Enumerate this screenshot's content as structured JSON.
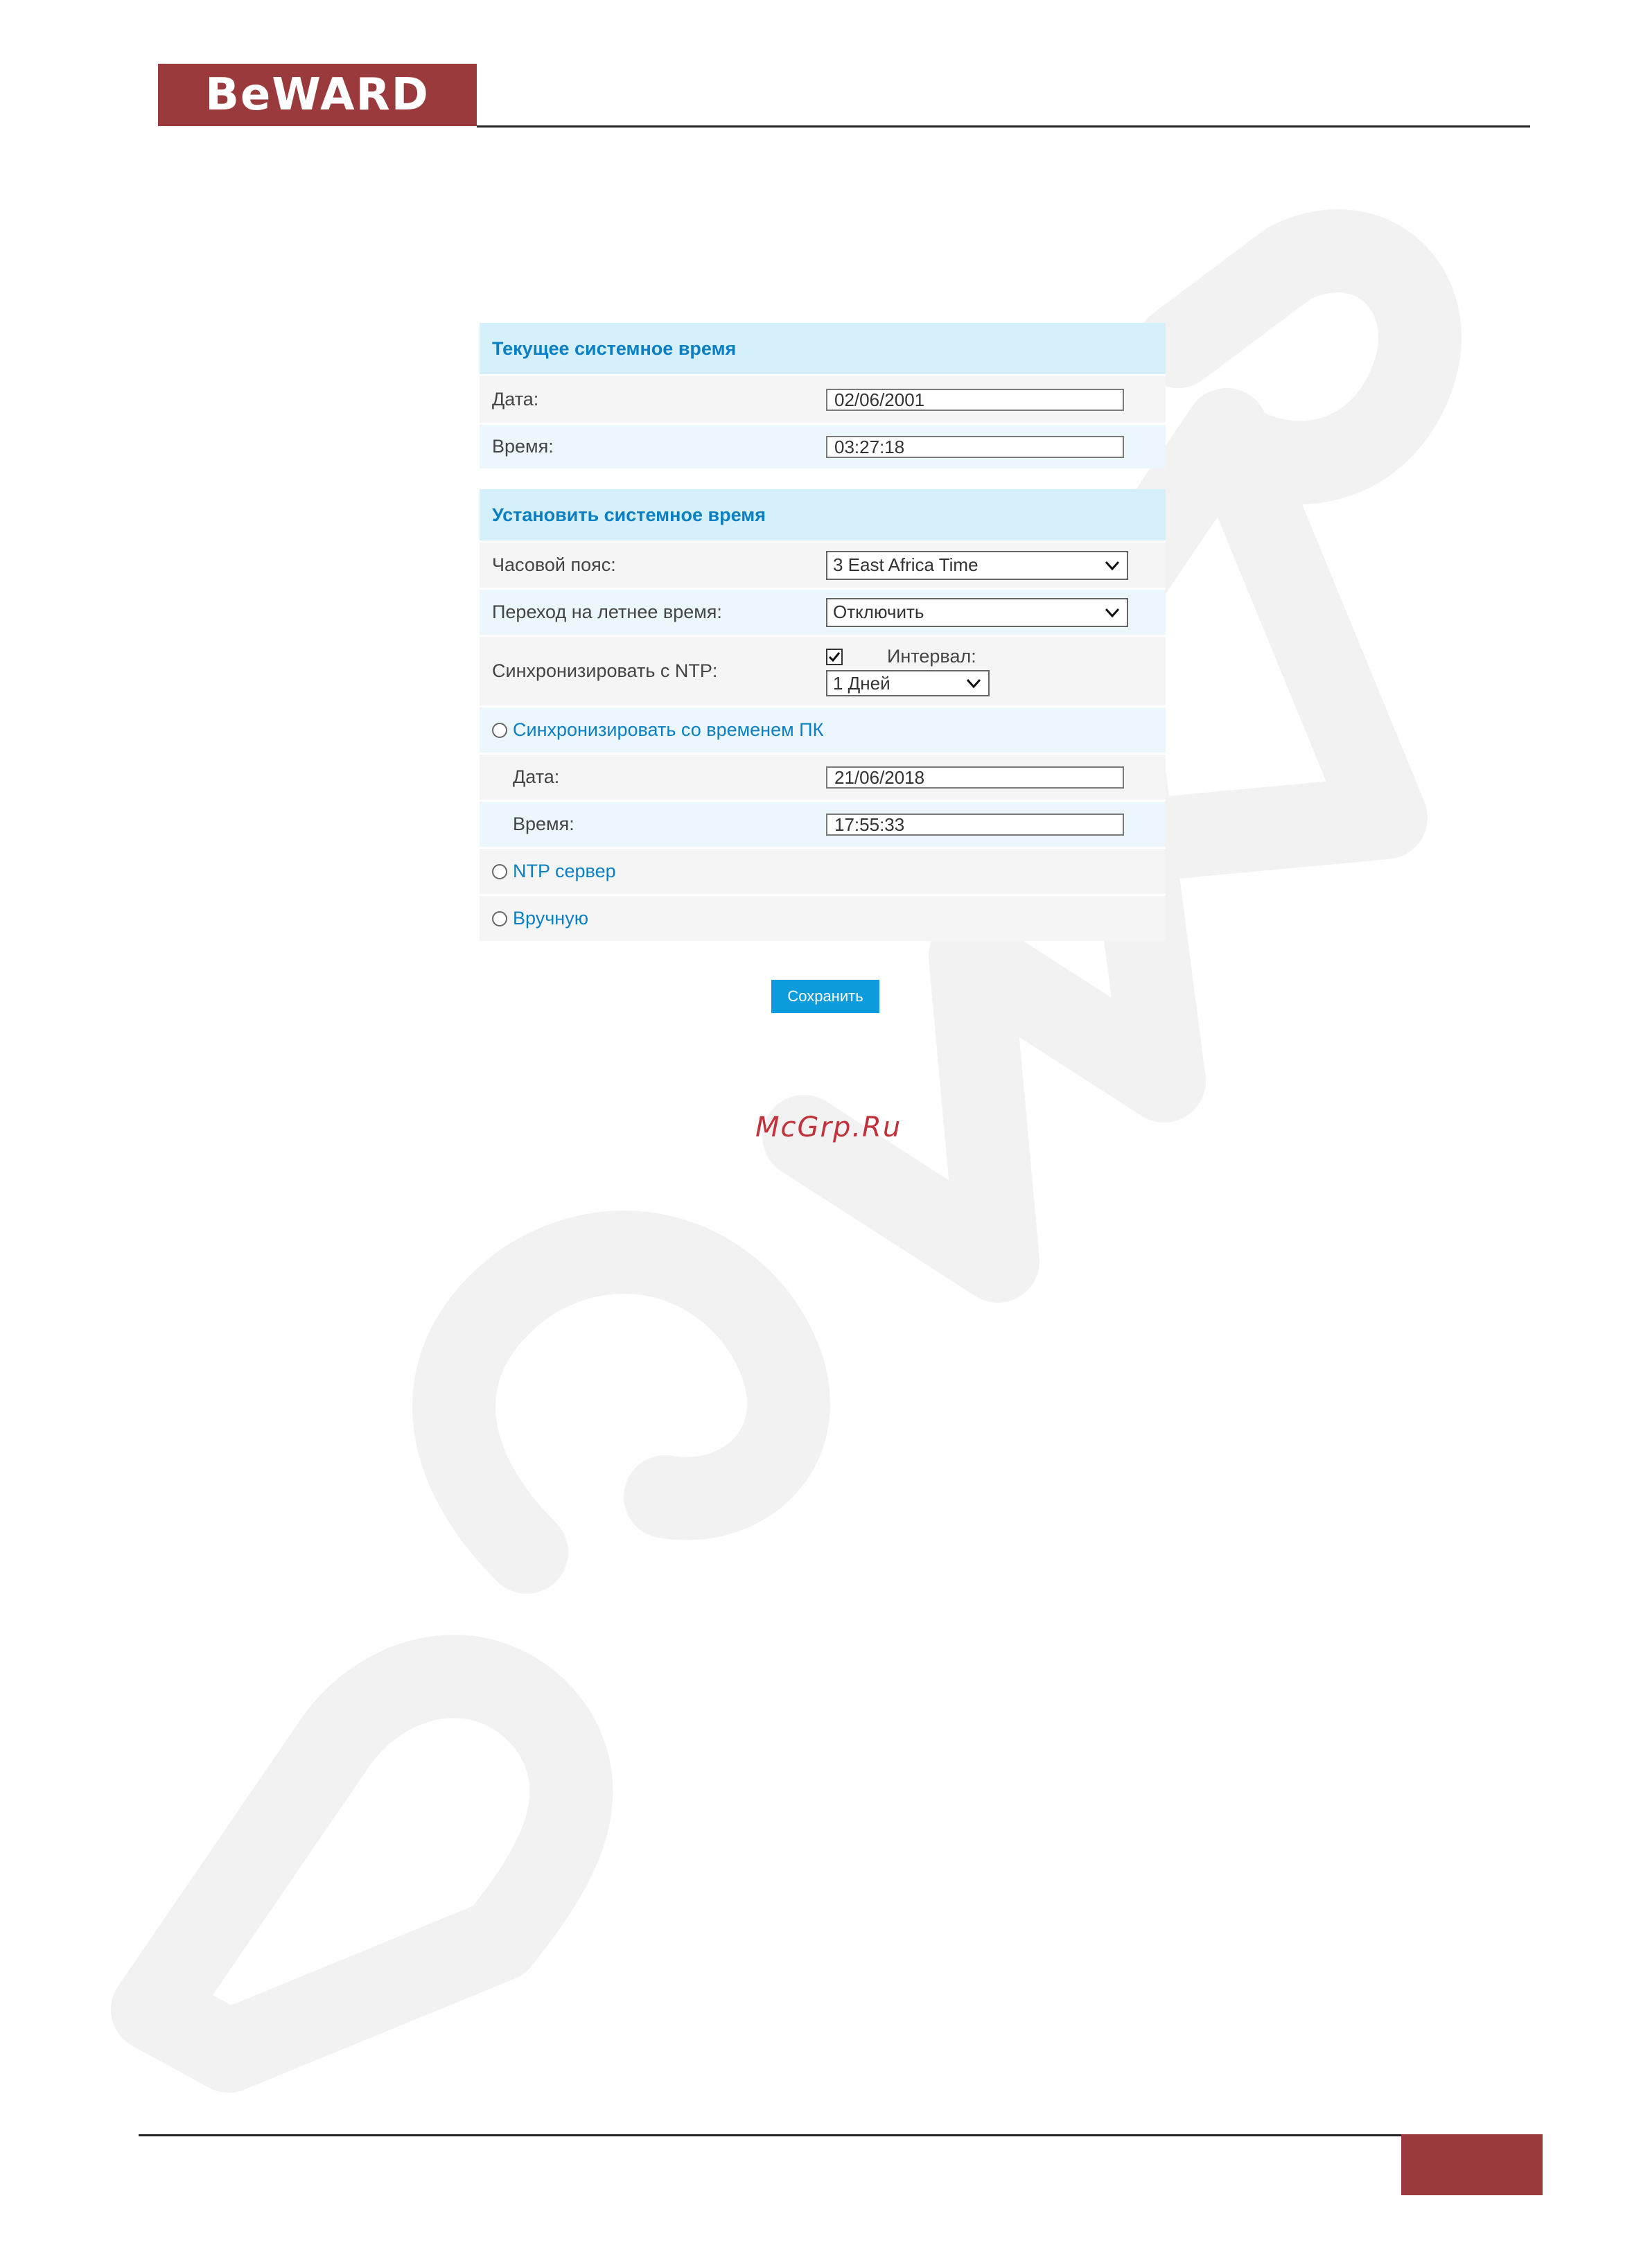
{
  "header": {
    "logo_text": "BeWARD"
  },
  "panel": {
    "current_time": {
      "title": "Текущее системное время",
      "date_label": "Дата:",
      "date_value": "02/06/2001",
      "time_label": "Время:",
      "time_value": "03:27:18"
    },
    "set_time": {
      "title": "Установить системное время",
      "timezone_label": "Часовой пояс:",
      "timezone_value": "3 East Africa Time",
      "dst_label": "Переход на летнее время:",
      "dst_value": "Отключить",
      "ntp_sync_label": "Синхронизировать с NTP:",
      "ntp_sync_checked": true,
      "interval_label": "Интервал:",
      "interval_value": "1 Дней",
      "pc_sync_label": "Синхронизировать со временем ПК",
      "pc_date_label": "Дата:",
      "pc_date_value": "21/06/2018",
      "pc_time_label": "Время:",
      "pc_time_value": "17:55:33",
      "ntp_server_label": "NTP сервер",
      "manual_label": "Вручную"
    },
    "save_label": "Сохранить"
  },
  "watermark": {
    "site": "McGrp.Ru"
  },
  "colors": {
    "brand": "#9b3a3c",
    "accent": "#0c9bdc",
    "section_bg": "#d5effb",
    "link": "#0b7fc3"
  }
}
